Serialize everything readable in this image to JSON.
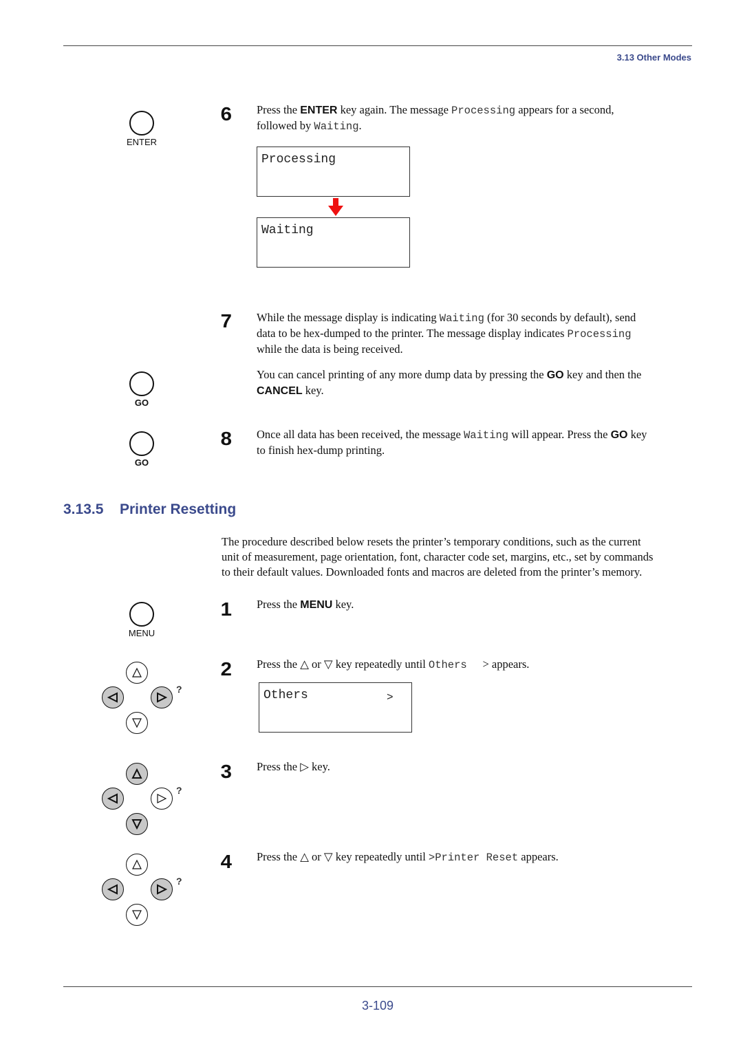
{
  "header": {
    "section_label": "3.13 Other Modes"
  },
  "footer": {
    "page_number": "3-109"
  },
  "keys": {
    "enter": "ENTER",
    "go": "GO",
    "menu": "MENU"
  },
  "steps_top": [
    {
      "number": "6",
      "text": {
        "p1": "Press the ",
        "k1": "ENTER",
        "p2": " key again. The message ",
        "m1": "Processing",
        "p3": " appears for a second,",
        "p4": "followed by ",
        "m2": "Waiting",
        "p5": "."
      },
      "lcd_screens": [
        "Processing",
        "Waiting"
      ]
    },
    {
      "number": "7",
      "text": {
        "p1": "While the message display is indicating ",
        "m1": "Waiting",
        "p2": " (for 30 seconds by default), send",
        "p3": "data to be hex-dumped to the printer. The message display indicates ",
        "m2": "Processing",
        "p4": "while the data is being received."
      },
      "note": {
        "p1": "You can cancel printing of any more dump data by pressing the ",
        "k1": "GO",
        "p2": " key and then the",
        "k2": "CANCEL",
        "p3": " key."
      }
    },
    {
      "number": "8",
      "text": {
        "p1": "Once all data has been received, the message ",
        "m1": "Waiting",
        "p2": " will appear. Press  the ",
        "k1": "GO",
        "p3": " key",
        "p4": "to finish hex-dump printing."
      }
    }
  ],
  "section": {
    "number": "3.13.5",
    "title": "Printer Resetting",
    "intro": [
      "The procedure described below resets the printer’s temporary conditions, such as the current",
      "unit of measurement, page orientation, font, character code set, margins, etc., set by commands",
      "to their default values. Downloaded fonts and macros are deleted from the printer’s memory."
    ]
  },
  "steps_bottom": [
    {
      "number": "1",
      "p1": "Press the ",
      "k1": "MENU",
      "p2": " key."
    },
    {
      "number": "2",
      "p1": "Press the △ or ▽ key repeatedly until ",
      "m1": "Others  ",
      "p2": " > appears.",
      "lcd": {
        "text": "Others",
        "arrow": ">"
      }
    },
    {
      "number": "3",
      "p1": "Press the ▷ key."
    },
    {
      "number": "4",
      "p1": "Press the △ or ▽ key repeatedly until ",
      "m1": ">Printer Reset",
      "p2": " appears."
    }
  ],
  "nav_pads": {
    "help_mark": "?",
    "pad_step2": {
      "up": "normal",
      "left": "highlighted",
      "right": "highlighted",
      "down": "normal"
    },
    "pad_step3": {
      "up": "highlighted",
      "left": "highlighted",
      "right": "normal",
      "down": "highlighted"
    },
    "pad_step4": {
      "up": "normal",
      "left": "highlighted",
      "right": "highlighted",
      "down": "normal"
    }
  },
  "colors": {
    "accent": "#3b4a8c",
    "arrow": "#ee1111",
    "highlight_key": "#c8c8c8"
  }
}
